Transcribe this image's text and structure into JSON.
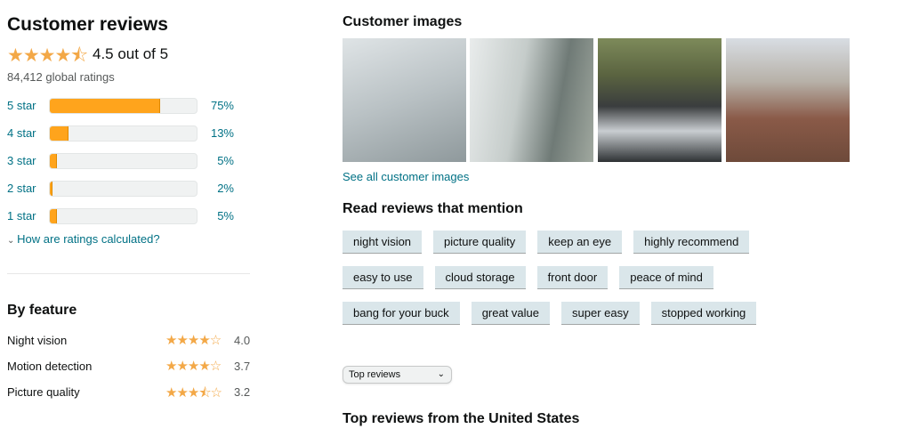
{
  "summary": {
    "title": "Customer reviews",
    "stars": "★★★★⯪",
    "rating_text": "4.5 out of 5",
    "rating": 4.5,
    "global_ratings": "84,412 global ratings",
    "histogram": [
      {
        "label": "5 star",
        "pct": "75%",
        "value": 75
      },
      {
        "label": "4 star",
        "pct": "13%",
        "value": 13
      },
      {
        "label": "3 star",
        "pct": "5%",
        "value": 5
      },
      {
        "label": "2 star",
        "pct": "2%",
        "value": 2
      },
      {
        "label": "1 star",
        "pct": "5%",
        "value": 5
      }
    ],
    "how_calculated": "How are ratings calculated?"
  },
  "features": {
    "title": "By feature",
    "items": [
      {
        "name": "Night vision",
        "stars": "★★★★☆",
        "value": "4.0"
      },
      {
        "name": "Motion detection",
        "stars": "★★★★☆",
        "value": "3.7"
      },
      {
        "name": "Picture quality",
        "stars": "★★★⯪☆",
        "value": "3.2"
      }
    ]
  },
  "images": {
    "title": "Customer images",
    "see_all": "See all customer images"
  },
  "mentions": {
    "title": "Read reviews that mention",
    "rows": [
      [
        "night vision",
        "picture quality",
        "keep an eye",
        "highly recommend"
      ],
      [
        "easy to use",
        "cloud storage",
        "front door",
        "peace of mind"
      ],
      [
        "bang for your buck",
        "great value",
        "super easy",
        "stopped working"
      ]
    ]
  },
  "sort": {
    "selected": "Top reviews"
  },
  "top_reviews_title": "Top reviews from the United States",
  "colors": {
    "accent": "#ffa41c",
    "link": "#007185",
    "chip": "#dae6ea"
  }
}
